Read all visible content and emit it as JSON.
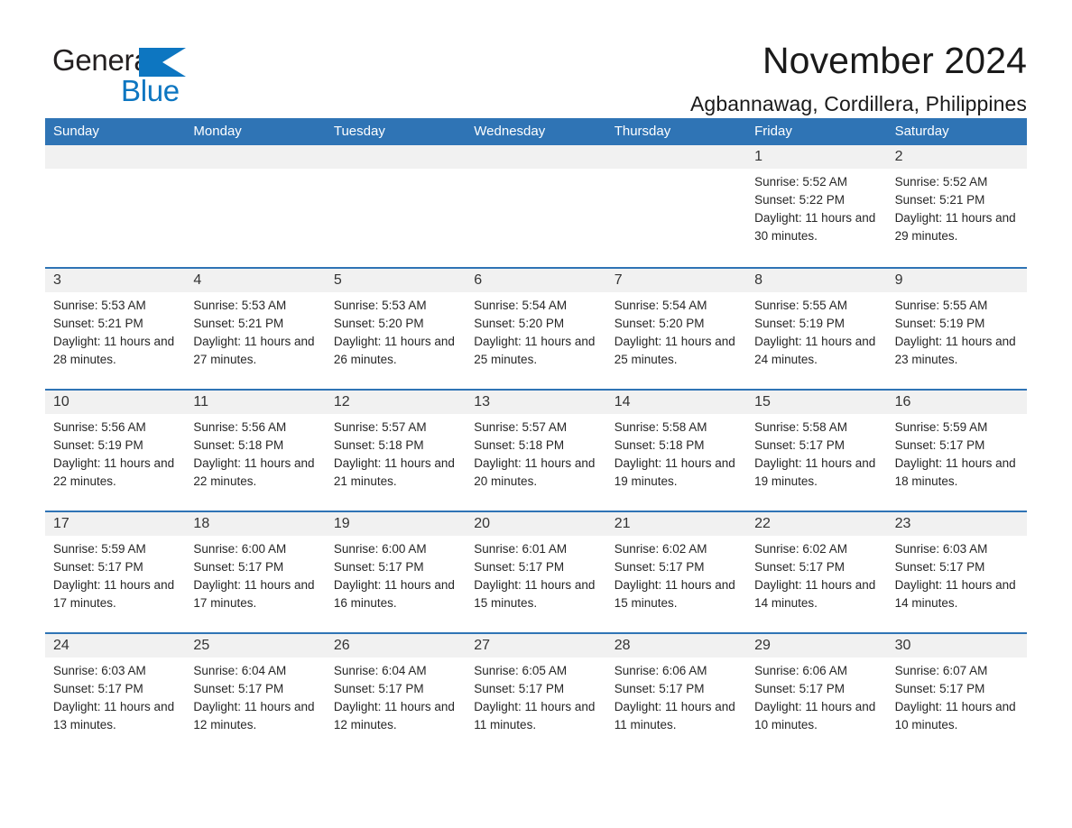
{
  "brand": {
    "word1": "General",
    "word2": "Blue",
    "triangle_color": "#0d76c1",
    "text_color": "#231f20"
  },
  "header": {
    "title": "November 2024",
    "subtitle": "Agbannawag, Cordillera, Philippines",
    "accent_color": "#2f74b5",
    "day_band_color": "#f1f1f1"
  },
  "calendar": {
    "weekdays": [
      "Sunday",
      "Monday",
      "Tuesday",
      "Wednesday",
      "Thursday",
      "Friday",
      "Saturday"
    ],
    "weeks": [
      [
        {
          "day": "",
          "empty": true
        },
        {
          "day": "",
          "empty": true
        },
        {
          "day": "",
          "empty": true
        },
        {
          "day": "",
          "empty": true
        },
        {
          "day": "",
          "empty": true
        },
        {
          "day": "1",
          "sunrise": "Sunrise: 5:52 AM",
          "sunset": "Sunset: 5:22 PM",
          "daylight": "Daylight: 11 hours and 30 minutes."
        },
        {
          "day": "2",
          "sunrise": "Sunrise: 5:52 AM",
          "sunset": "Sunset: 5:21 PM",
          "daylight": "Daylight: 11 hours and 29 minutes."
        }
      ],
      [
        {
          "day": "3",
          "sunrise": "Sunrise: 5:53 AM",
          "sunset": "Sunset: 5:21 PM",
          "daylight": "Daylight: 11 hours and 28 minutes."
        },
        {
          "day": "4",
          "sunrise": "Sunrise: 5:53 AM",
          "sunset": "Sunset: 5:21 PM",
          "daylight": "Daylight: 11 hours and 27 minutes."
        },
        {
          "day": "5",
          "sunrise": "Sunrise: 5:53 AM",
          "sunset": "Sunset: 5:20 PM",
          "daylight": "Daylight: 11 hours and 26 minutes."
        },
        {
          "day": "6",
          "sunrise": "Sunrise: 5:54 AM",
          "sunset": "Sunset: 5:20 PM",
          "daylight": "Daylight: 11 hours and 25 minutes."
        },
        {
          "day": "7",
          "sunrise": "Sunrise: 5:54 AM",
          "sunset": "Sunset: 5:20 PM",
          "daylight": "Daylight: 11 hours and 25 minutes."
        },
        {
          "day": "8",
          "sunrise": "Sunrise: 5:55 AM",
          "sunset": "Sunset: 5:19 PM",
          "daylight": "Daylight: 11 hours and 24 minutes."
        },
        {
          "day": "9",
          "sunrise": "Sunrise: 5:55 AM",
          "sunset": "Sunset: 5:19 PM",
          "daylight": "Daylight: 11 hours and 23 minutes."
        }
      ],
      [
        {
          "day": "10",
          "sunrise": "Sunrise: 5:56 AM",
          "sunset": "Sunset: 5:19 PM",
          "daylight": "Daylight: 11 hours and 22 minutes."
        },
        {
          "day": "11",
          "sunrise": "Sunrise: 5:56 AM",
          "sunset": "Sunset: 5:18 PM",
          "daylight": "Daylight: 11 hours and 22 minutes."
        },
        {
          "day": "12",
          "sunrise": "Sunrise: 5:57 AM",
          "sunset": "Sunset: 5:18 PM",
          "daylight": "Daylight: 11 hours and 21 minutes."
        },
        {
          "day": "13",
          "sunrise": "Sunrise: 5:57 AM",
          "sunset": "Sunset: 5:18 PM",
          "daylight": "Daylight: 11 hours and 20 minutes."
        },
        {
          "day": "14",
          "sunrise": "Sunrise: 5:58 AM",
          "sunset": "Sunset: 5:18 PM",
          "daylight": "Daylight: 11 hours and 19 minutes."
        },
        {
          "day": "15",
          "sunrise": "Sunrise: 5:58 AM",
          "sunset": "Sunset: 5:17 PM",
          "daylight": "Daylight: 11 hours and 19 minutes."
        },
        {
          "day": "16",
          "sunrise": "Sunrise: 5:59 AM",
          "sunset": "Sunset: 5:17 PM",
          "daylight": "Daylight: 11 hours and 18 minutes."
        }
      ],
      [
        {
          "day": "17",
          "sunrise": "Sunrise: 5:59 AM",
          "sunset": "Sunset: 5:17 PM",
          "daylight": "Daylight: 11 hours and 17 minutes."
        },
        {
          "day": "18",
          "sunrise": "Sunrise: 6:00 AM",
          "sunset": "Sunset: 5:17 PM",
          "daylight": "Daylight: 11 hours and 17 minutes."
        },
        {
          "day": "19",
          "sunrise": "Sunrise: 6:00 AM",
          "sunset": "Sunset: 5:17 PM",
          "daylight": "Daylight: 11 hours and 16 minutes."
        },
        {
          "day": "20",
          "sunrise": "Sunrise: 6:01 AM",
          "sunset": "Sunset: 5:17 PM",
          "daylight": "Daylight: 11 hours and 15 minutes."
        },
        {
          "day": "21",
          "sunrise": "Sunrise: 6:02 AM",
          "sunset": "Sunset: 5:17 PM",
          "daylight": "Daylight: 11 hours and 15 minutes."
        },
        {
          "day": "22",
          "sunrise": "Sunrise: 6:02 AM",
          "sunset": "Sunset: 5:17 PM",
          "daylight": "Daylight: 11 hours and 14 minutes."
        },
        {
          "day": "23",
          "sunrise": "Sunrise: 6:03 AM",
          "sunset": "Sunset: 5:17 PM",
          "daylight": "Daylight: 11 hours and 14 minutes."
        }
      ],
      [
        {
          "day": "24",
          "sunrise": "Sunrise: 6:03 AM",
          "sunset": "Sunset: 5:17 PM",
          "daylight": "Daylight: 11 hours and 13 minutes."
        },
        {
          "day": "25",
          "sunrise": "Sunrise: 6:04 AM",
          "sunset": "Sunset: 5:17 PM",
          "daylight": "Daylight: 11 hours and 12 minutes."
        },
        {
          "day": "26",
          "sunrise": "Sunrise: 6:04 AM",
          "sunset": "Sunset: 5:17 PM",
          "daylight": "Daylight: 11 hours and 12 minutes."
        },
        {
          "day": "27",
          "sunrise": "Sunrise: 6:05 AM",
          "sunset": "Sunset: 5:17 PM",
          "daylight": "Daylight: 11 hours and 11 minutes."
        },
        {
          "day": "28",
          "sunrise": "Sunrise: 6:06 AM",
          "sunset": "Sunset: 5:17 PM",
          "daylight": "Daylight: 11 hours and 11 minutes."
        },
        {
          "day": "29",
          "sunrise": "Sunrise: 6:06 AM",
          "sunset": "Sunset: 5:17 PM",
          "daylight": "Daylight: 11 hours and 10 minutes."
        },
        {
          "day": "30",
          "sunrise": "Sunrise: 6:07 AM",
          "sunset": "Sunset: 5:17 PM",
          "daylight": "Daylight: 11 hours and 10 minutes."
        }
      ]
    ]
  }
}
